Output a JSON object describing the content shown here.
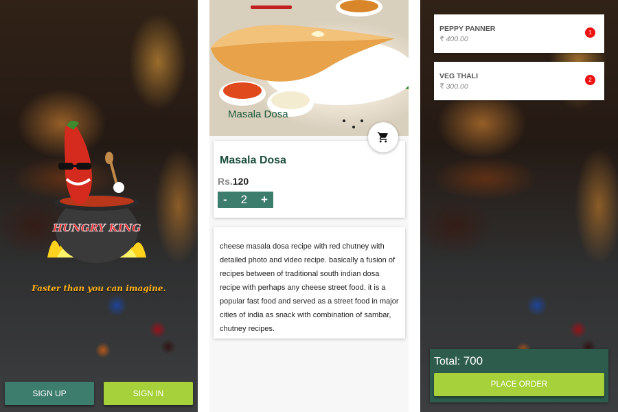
{
  "splash": {
    "brand": "HUNGRY KING",
    "tagline": "Faster than you can imagine.",
    "signup_label": "SIGN UP",
    "signin_label": "SIGN IN",
    "colors": {
      "signup": "#3d7d6d",
      "signin": "#a7d13a",
      "tagline": "#ffb21e"
    }
  },
  "detail": {
    "hero_caption": "Masala Dosa",
    "cart_icon": "shopping-cart-icon",
    "product_name": "Masala Dosa",
    "price_currency": "Rs.",
    "price_value": "120",
    "qty_minus": "-",
    "qty_value": "2",
    "qty_plus": "+",
    "description": "cheese masala dosa recipe with red chutney with detailed photo and video recipe. basically a fusion of recipes between of traditional south indian dosa recipe with perhaps any cheese street food. it is a popular fast food and served as a street food in major cities of india as snack with combination of sambar, chutney recipes."
  },
  "cart": {
    "items": [
      {
        "name": "PEPPY PANNER",
        "price": "₹ 400.00",
        "qty": "1"
      },
      {
        "name": "VEG THALI",
        "price": "₹ 300.00",
        "qty": "2"
      }
    ],
    "total_label": "Total:",
    "total_value": "700",
    "place_order_label": "PLACE ORDER",
    "colors": {
      "total_bg": "#2d5c4d",
      "place_order": "#a7d13a",
      "badge": "#ee1111"
    }
  }
}
